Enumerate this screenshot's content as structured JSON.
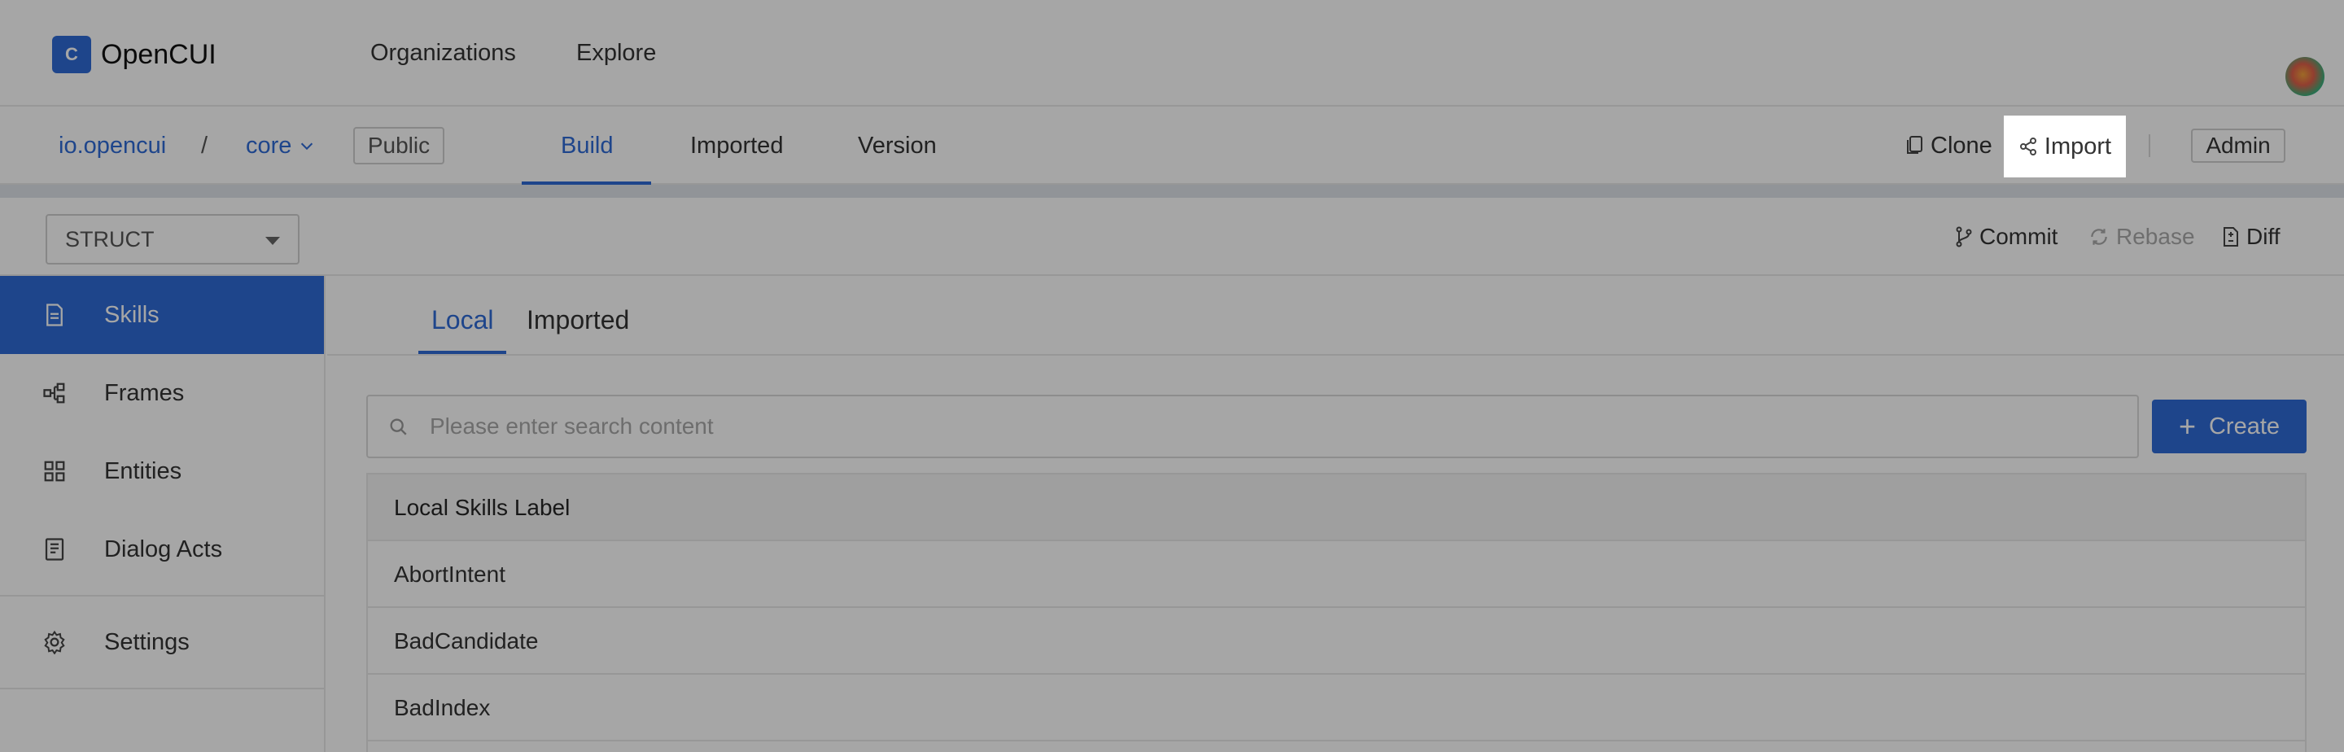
{
  "header": {
    "logo_mark": "C",
    "app_name": "OpenCUI",
    "nav": [
      "Organizations",
      "Explore"
    ]
  },
  "project": {
    "org": "io.opencui",
    "separator": "/",
    "name": "core",
    "visibility": "Public",
    "tabs": [
      "Build",
      "Imported",
      "Version"
    ],
    "active_tab": "Build",
    "clone_label": "Clone",
    "import_label": "Import",
    "admin_label": "Admin"
  },
  "toolbar": {
    "type_select": "STRUCT",
    "commit_label": "Commit",
    "rebase_label": "Rebase",
    "diff_label": "Diff"
  },
  "sidebar": {
    "items": [
      {
        "label": "Skills",
        "icon": "document-icon",
        "active": true
      },
      {
        "label": "Frames",
        "icon": "frames-icon",
        "active": false
      },
      {
        "label": "Entities",
        "icon": "entities-icon",
        "active": false
      },
      {
        "label": "Dialog Acts",
        "icon": "dialog-acts-icon",
        "active": false
      },
      {
        "label": "Settings",
        "icon": "gear-icon",
        "active": false
      }
    ]
  },
  "main": {
    "subtabs": [
      "Local",
      "Imported"
    ],
    "active_subtab": "Local",
    "search": {
      "placeholder": "Please enter search content",
      "value": ""
    },
    "create_label": "Create",
    "table": {
      "header": "Local Skills Label",
      "rows": [
        "AbortIntent",
        "BadCandidate",
        "BadIndex"
      ]
    }
  },
  "colors": {
    "accent": "#2f6bd6",
    "overlay": "rgba(0,0,0,0.35)"
  }
}
